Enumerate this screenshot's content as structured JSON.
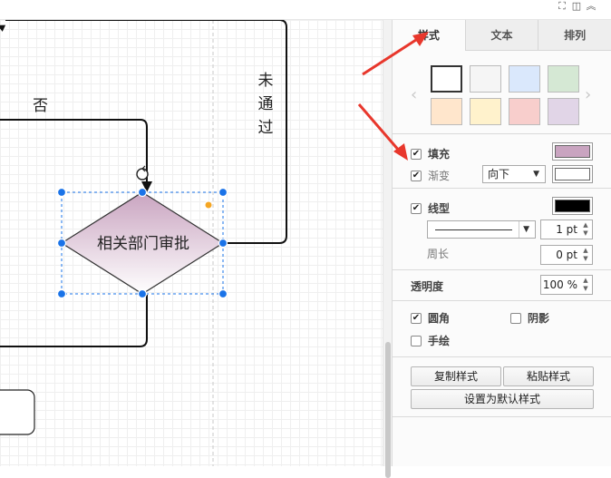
{
  "toolbar": {
    "icons": [
      "fullscreen-icon",
      "panel-toggle-icon",
      "collapse-icon"
    ]
  },
  "canvas": {
    "shape_label": "相关部门审批",
    "edge_label_no": "否",
    "edge_label_rejected": "未通过",
    "shape_fill_top": "#c9a4c0",
    "shape_fill_bottom": "#ffffff",
    "selection_color": "#1a73e8"
  },
  "panel": {
    "tabs": [
      {
        "label": "样式",
        "active": true
      },
      {
        "label": "文本",
        "active": false
      },
      {
        "label": "排列",
        "active": false
      }
    ],
    "swatches": [
      "#ffffff",
      "#f5f5f5",
      "#dae8fc",
      "#d5e8d4",
      "#ffe6cc",
      "#fff2cc",
      "#f8cecc",
      "#e1d5e7"
    ],
    "fill": {
      "label": "填充",
      "checked": true,
      "color": "#c9a4c0"
    },
    "gradient": {
      "label": "渐变",
      "checked": true,
      "direction": "向下",
      "color": "#ffffff"
    },
    "line": {
      "label": "线型",
      "checked": true,
      "color": "#000000",
      "width": "1 pt"
    },
    "perimeter": {
      "label": "周长",
      "value": "0 pt"
    },
    "opacity": {
      "label": "透明度",
      "value": "100 %"
    },
    "rounded": {
      "label": "圆角",
      "checked": true
    },
    "shadow": {
      "label": "阴影",
      "checked": false
    },
    "sketch": {
      "label": "手绘",
      "checked": false
    },
    "buttons": {
      "copy_style": "复制样式",
      "paste_style": "粘贴样式",
      "set_default": "设置为默认样式"
    }
  },
  "annotation_color": "#e8372c"
}
